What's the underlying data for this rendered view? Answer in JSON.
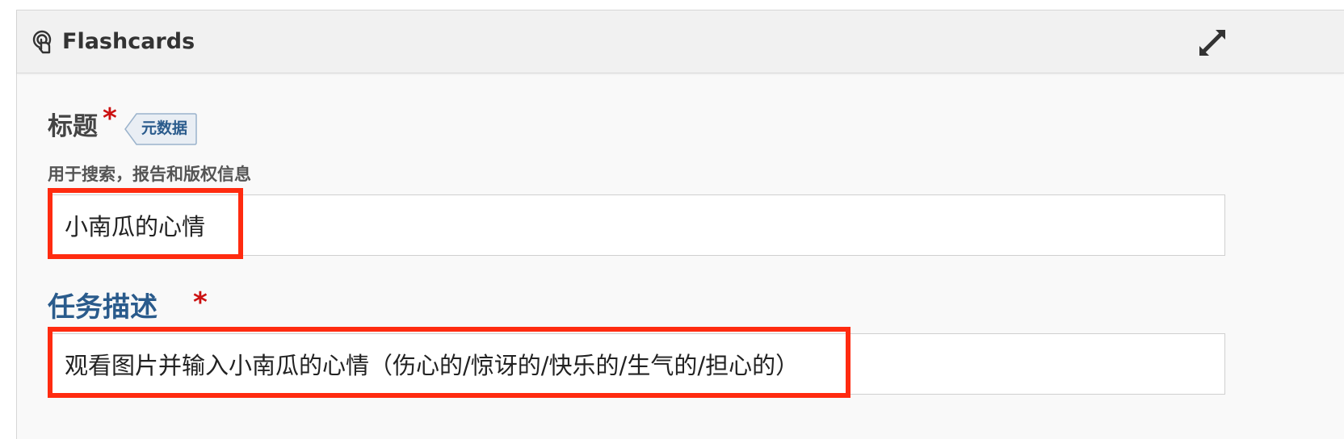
{
  "panel": {
    "title": "Flashcards",
    "icon": "touch-icon",
    "expand_icon": "expand-icon"
  },
  "fields": {
    "title": {
      "label": "标题",
      "required_mark": "*",
      "badge": "元数据",
      "description": "用于搜索，报告和版权信息",
      "value": "小南瓜的心情"
    },
    "task": {
      "label": "任务描述",
      "required_mark": "*",
      "value": "观看图片并输入小南瓜的心情（伤心的/惊讶的/快乐的/生气的/担心的）"
    }
  },
  "colors": {
    "highlight": "#ff2b10",
    "task_label": "#2a5b8c",
    "required": "#cc1111"
  }
}
